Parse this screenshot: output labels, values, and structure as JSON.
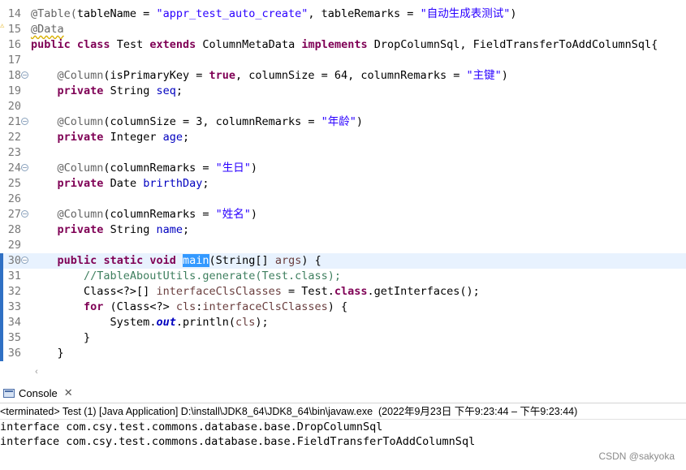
{
  "editor": {
    "lines": {
      "l14": {
        "num": "14",
        "c1": "@Table(",
        "c2": "tableName = ",
        "c3": "\"appr_test_auto_create\"",
        "c4": ", tableRemarks = ",
        "c5": "\"自动生成表测试\"",
        "c6": ")"
      },
      "l15": {
        "num": "15",
        "c1": "@Data"
      },
      "l16": {
        "num": "16",
        "k1": "public",
        "k2": "class",
        "k3": "extends",
        "k4": "implements",
        "t1": "Test",
        "t2": "ColumnMetaData",
        "t3": "DropColumnSql, FieldTransferToAddColumnSql{"
      },
      "l17": {
        "num": "17"
      },
      "l18": {
        "num": "18",
        "c1": "@Column",
        "c2": "(isPrimaryKey = ",
        "k1": "true",
        "c3": ", columnSize = 64, columnRemarks = ",
        "s1": "\"主键\"",
        "c4": ")"
      },
      "l19": {
        "num": "19",
        "k1": "private",
        "t1": "String",
        "f1": "seq",
        "p": ";"
      },
      "l20": {
        "num": "20"
      },
      "l21": {
        "num": "21",
        "c1": "@Column",
        "c2": "(columnSize = 3, columnRemarks = ",
        "s1": "\"年龄\"",
        "c3": ")"
      },
      "l22": {
        "num": "22",
        "k1": "private",
        "t1": "Integer",
        "f1": "age",
        "p": ";"
      },
      "l23": {
        "num": "23"
      },
      "l24": {
        "num": "24",
        "c1": "@Column",
        "c2": "(columnRemarks = ",
        "s1": "\"生日\"",
        "c3": ")"
      },
      "l25": {
        "num": "25",
        "k1": "private",
        "t1": "Date",
        "f1": "brirthDay",
        "p": ";"
      },
      "l26": {
        "num": "26"
      },
      "l27": {
        "num": "27",
        "c1": "@Column",
        "c2": "(columnRemarks = ",
        "s1": "\"姓名\"",
        "c3": ")"
      },
      "l28": {
        "num": "28",
        "k1": "private",
        "t1": "String",
        "f1": "name",
        "p": ";"
      },
      "l29": {
        "num": "29"
      },
      "l30": {
        "num": "30",
        "k1": "public",
        "k2": "static",
        "k3": "void",
        "sel": "main",
        "t1": "(String[] ",
        "p1": "args",
        "t2": ") {"
      },
      "l31": {
        "num": "31",
        "cm": "//TableAboutUtils.generate(Test.class);"
      },
      "l32": {
        "num": "32",
        "t1": "Class<?>[] ",
        "v1": "interfaceClsClasses",
        "t2": " = Test.",
        "k1": "class",
        "t3": ".getInterfaces();"
      },
      "l33": {
        "num": "33",
        "k1": "for",
        "t1": " (Class<?> ",
        "v1": "cls",
        "t2": ":",
        "v2": "interfaceClsClasses",
        "t3": ") {"
      },
      "l34": {
        "num": "34",
        "t1": "System.",
        "sf": "out",
        "t2": ".println(",
        "v1": "cls",
        "t3": ");"
      },
      "l35": {
        "num": "35",
        "t1": "}"
      },
      "l36": {
        "num": "36",
        "t1": "}"
      }
    }
  },
  "console": {
    "tab_label": "Console",
    "close_glyph": "✕",
    "status": "<terminated> Test (1) [Java Application] D:\\install\\JDK8_64\\JDK8_64\\bin\\javaw.exe  (2022年9月23日 下午9:23:44 – 下午9:23:44)",
    "output": [
      "interface com.csy.test.commons.database.base.DropColumnSql",
      "interface com.csy.test.commons.database.base.FieldTransferToAddColumnSql"
    ]
  },
  "watermark": "CSDN @sakyoka",
  "icons": {
    "fold": "fold-toggle-icon",
    "warning": "warning-icon",
    "console": "console-icon",
    "close": "close-icon",
    "scroll_left": "scroll-left-arrow-icon"
  }
}
